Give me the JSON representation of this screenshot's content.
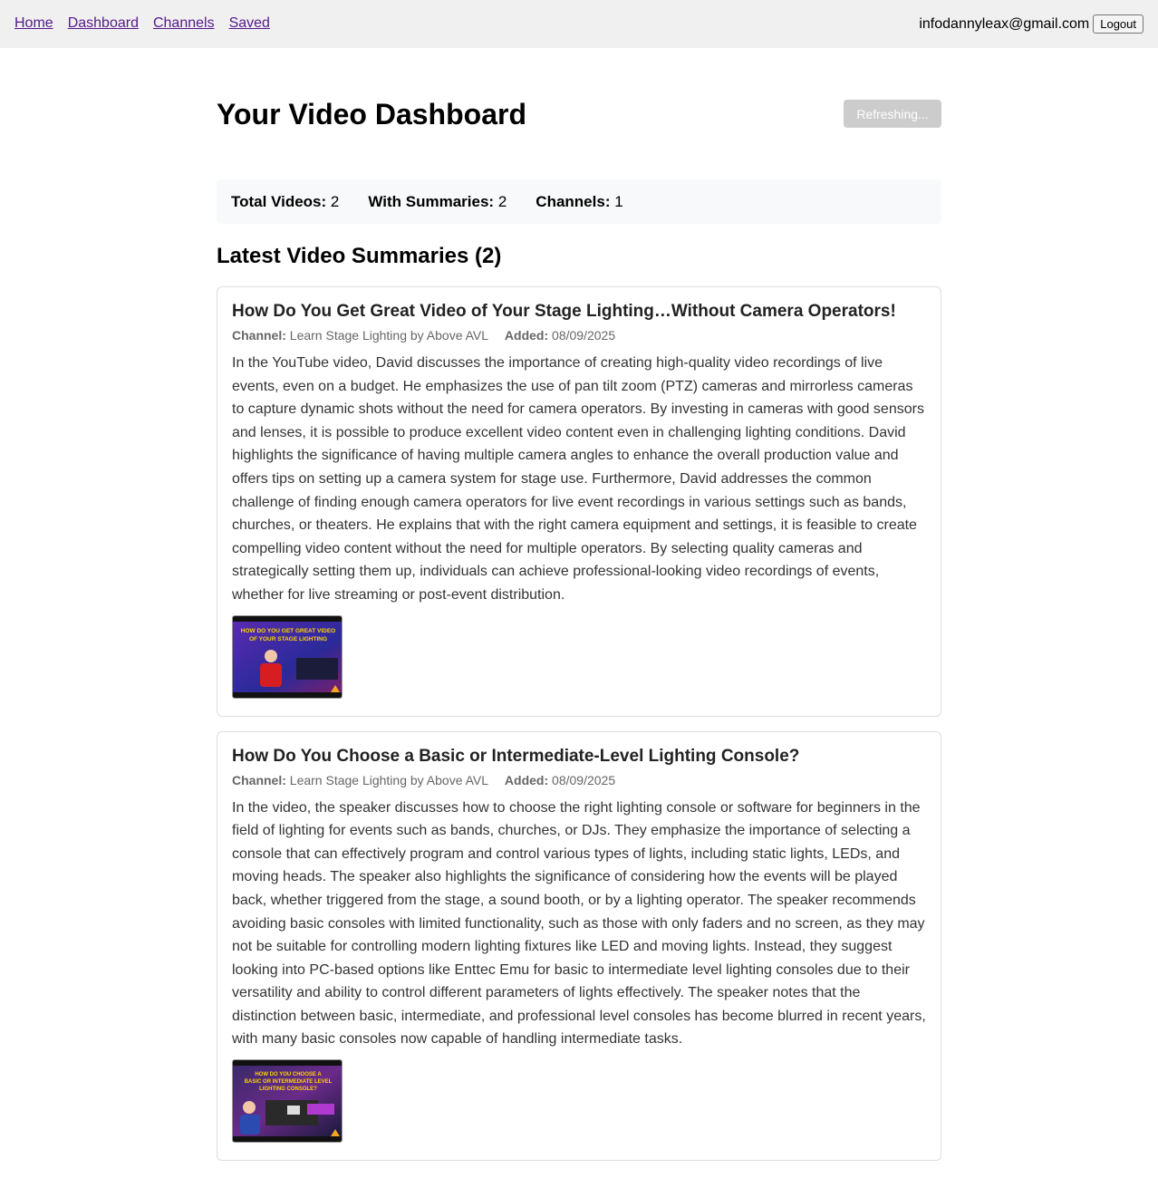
{
  "nav": {
    "links": [
      "Home",
      "Dashboard",
      "Channels",
      "Saved"
    ],
    "user_email": "infodannyleax@gmail.com",
    "logout_label": "Logout"
  },
  "header": {
    "title": "Your Video Dashboard",
    "refresh_label": "Refreshing..."
  },
  "stats": {
    "total_label": "Total Videos:",
    "total_value": "2",
    "summaries_label": "With Summaries:",
    "summaries_value": "2",
    "channels_label": "Channels:",
    "channels_value": "1"
  },
  "section_title": "Latest Video Summaries (2)",
  "videos": [
    {
      "title": "How Do You Get Great Video of Your Stage Lighting…Without Camera Operators!",
      "channel_label": "Channel:",
      "channel": "Learn Stage Lighting by Above AVL",
      "added_label": "Added:",
      "added": "08/09/2025",
      "summary": "In the YouTube video, David discusses the importance of creating high-quality video recordings of live events, even on a budget. He emphasizes the use of pan tilt zoom (PTZ) cameras and mirrorless cameras to capture dynamic shots without the need for camera operators. By investing in cameras with good sensors and lenses, it is possible to produce excellent video content even in challenging lighting conditions. David highlights the significance of having multiple camera angles to enhance the overall production value and offers tips on setting up a camera system for stage use. Furthermore, David addresses the common challenge of finding enough camera operators for live event recordings in various settings such as bands, churches, or theaters. He explains that with the right camera equipment and settings, it is feasible to create compelling video content without the need for multiple operators. By selecting quality cameras and strategically setting them up, individuals can achieve professional-looking video recordings of events, whether for live streaming or post-event distribution.",
      "thumb_text": [
        "HOW DO YOU GET GREAT VIDEO",
        "OF YOUR STAGE LIGHTING"
      ]
    },
    {
      "title": "How Do You Choose a Basic or Intermediate-Level Lighting Console?",
      "channel_label": "Channel:",
      "channel": "Learn Stage Lighting by Above AVL",
      "added_label": "Added:",
      "added": "08/09/2025",
      "summary": "In the video, the speaker discusses how to choose the right lighting console or software for beginners in the field of lighting for events such as bands, churches, or DJs. They emphasize the importance of selecting a console that can effectively program and control various types of lights, including static lights, LEDs, and moving heads. The speaker also highlights the significance of considering how the events will be played back, whether triggered from the stage, a sound booth, or by a lighting operator. The speaker recommends avoiding basic consoles with limited functionality, such as those with only faders and no screen, as they may not be suitable for controlling modern lighting fixtures like LED and moving lights. Instead, they suggest looking into PC-based options like Enttec Emu for basic to intermediate level lighting consoles due to their versatility and ability to control different parameters of lights effectively. The speaker notes that the distinction between basic, intermediate, and professional level consoles has become blurred in recent years, with many basic consoles now capable of handling intermediate tasks.",
      "thumb_text": [
        "HOW DO YOU CHOOSE A",
        "BASIC OR INTERMEDIATE LEVEL",
        "LIGHTING CONSOLE?"
      ]
    }
  ],
  "colors": {
    "topbar_bg": "#f0f0f0",
    "link": "#551a8b",
    "stats_bg": "#f8f9fa",
    "refresh_bg": "#cccccc",
    "card_border": "#dddddd"
  }
}
